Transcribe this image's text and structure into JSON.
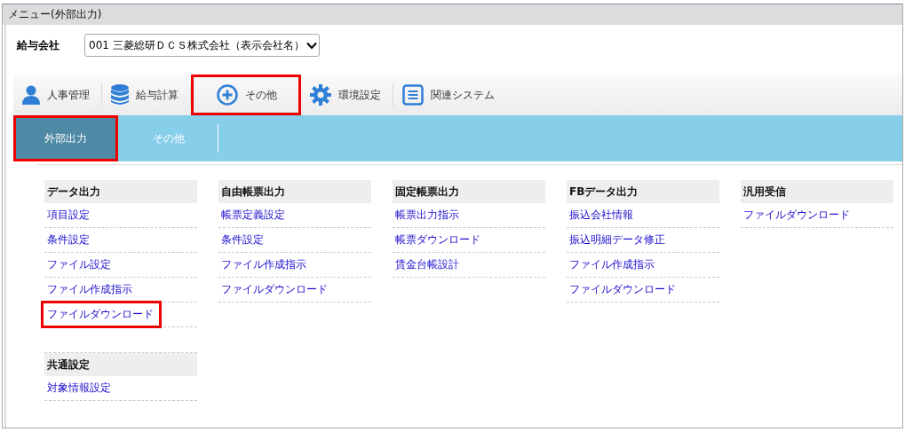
{
  "window": {
    "title": "メニュー(外部出力)"
  },
  "company": {
    "label": "給与会社",
    "value": "001 三菱総研ＤＣＳ株式会社（表示会社名）"
  },
  "nav_tabs": [
    {
      "label": "人事管理",
      "highlighted": false
    },
    {
      "label": "給与計算",
      "highlighted": false
    },
    {
      "label": "その他",
      "highlighted": true
    },
    {
      "label": "環境設定",
      "highlighted": false
    },
    {
      "label": "関連システム",
      "highlighted": false
    }
  ],
  "sub_tabs": [
    {
      "label": "外部出力",
      "selected": true,
      "highlighted": true
    },
    {
      "label": "その他",
      "selected": false,
      "highlighted": false
    }
  ],
  "columns": [
    {
      "groups": [
        {
          "title": "データ出力",
          "items": [
            {
              "label": "項目設定",
              "highlighted": false
            },
            {
              "label": "条件設定",
              "highlighted": false
            },
            {
              "label": "ファイル設定",
              "highlighted": false
            },
            {
              "label": "ファイル作成指示",
              "highlighted": false
            },
            {
              "label": "ファイルダウンロード",
              "highlighted": true
            }
          ]
        },
        {
          "title": "共通設定",
          "items": [
            {
              "label": "対象情報設定",
              "highlighted": false
            }
          ]
        }
      ]
    },
    {
      "groups": [
        {
          "title": "自由帳票出力",
          "items": [
            {
              "label": "帳票定義設定",
              "highlighted": false
            },
            {
              "label": "条件設定",
              "highlighted": false
            },
            {
              "label": "ファイル作成指示",
              "highlighted": false
            },
            {
              "label": "ファイルダウンロード",
              "highlighted": false
            }
          ]
        }
      ]
    },
    {
      "groups": [
        {
          "title": "固定帳票出力",
          "items": [
            {
              "label": "帳票出力指示",
              "highlighted": false
            },
            {
              "label": "帳票ダウンロード",
              "highlighted": false
            },
            {
              "label": "賃金台帳設計",
              "highlighted": false
            }
          ]
        }
      ]
    },
    {
      "groups": [
        {
          "title": "FBデータ出力",
          "items": [
            {
              "label": "振込会社情報",
              "highlighted": false
            },
            {
              "label": "振込明細データ修正",
              "highlighted": false
            },
            {
              "label": "ファイル作成指示",
              "highlighted": false
            },
            {
              "label": "ファイルダウンロード",
              "highlighted": false
            }
          ]
        }
      ]
    },
    {
      "groups": [
        {
          "title": "汎用受信",
          "items": [
            {
              "label": "ファイルダウンロード",
              "highlighted": false
            }
          ]
        }
      ]
    }
  ]
}
